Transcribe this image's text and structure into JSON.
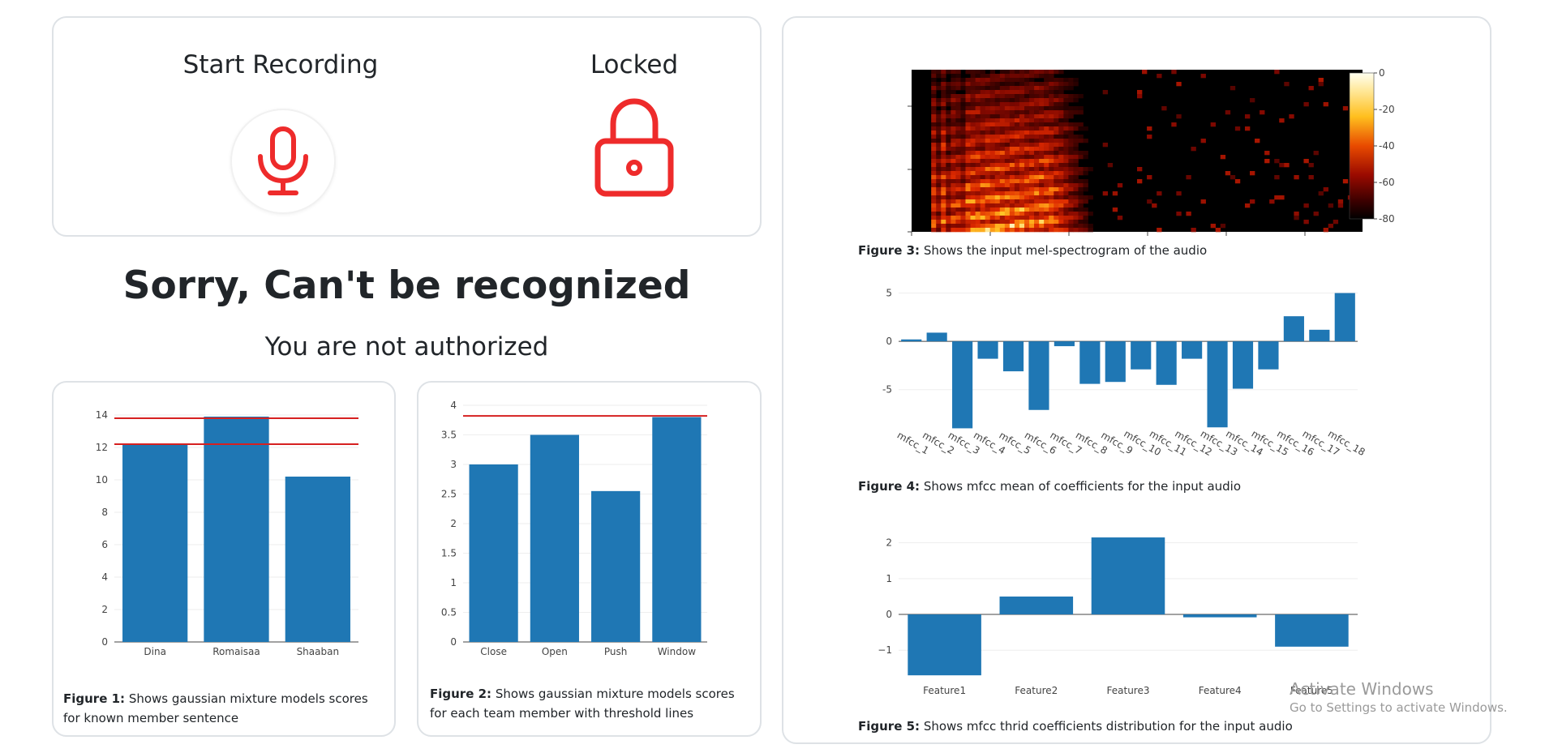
{
  "record": {
    "start_title": "Start Recording",
    "locked_title": "Locked"
  },
  "result": {
    "title": "Sorry, Can't be recognized",
    "subtitle": "You are not authorized"
  },
  "colors": {
    "accent_red": "#ee2b2b",
    "bar_blue": "#1f77b4",
    "threshold_red": "#d62020"
  },
  "icons": {
    "mic": "microphone-icon",
    "lock": "lock-icon"
  },
  "figures": {
    "fig1": {
      "label": "Figure 1:",
      "text": " Shows gaussian mixture models scores for known member sentence"
    },
    "fig2": {
      "label": "Figure 2:",
      "text": " Shows gaussian mixture models scores for each team member with threshold lines"
    },
    "fig3": {
      "label": "Figure 3:",
      "text": " Shows the input mel-spectrogram of the audio"
    },
    "fig4": {
      "label": "Figure 4:",
      "text": " Shows mfcc mean of coefficients for the input audio"
    },
    "fig5": {
      "label": "Figure 5:",
      "text": " Shows mfcc thrid coefficients distribution for the input audio"
    }
  },
  "chart_data": [
    {
      "id": "fig1",
      "type": "bar",
      "categories": [
        "Dina",
        "Romaisaa",
        "Shaaban"
      ],
      "values": [
        12.2,
        13.9,
        10.2
      ],
      "ylim": [
        0,
        14.6
      ],
      "yticks": [
        0,
        2,
        4,
        6,
        8,
        10,
        12,
        14
      ],
      "thresholds": [
        13.8,
        12.2
      ]
    },
    {
      "id": "fig2",
      "type": "bar",
      "categories": [
        "Close",
        "Open",
        "Push",
        "Window"
      ],
      "values": [
        3.0,
        3.5,
        2.55,
        3.8
      ],
      "ylim": [
        0,
        4
      ],
      "yticks": [
        0,
        0.5,
        1,
        1.5,
        2,
        2.5,
        3,
        3.5,
        4
      ],
      "thresholds": [
        3.82
      ]
    },
    {
      "id": "fig3",
      "type": "heatmap",
      "colorbar_ticks": [
        0,
        -20,
        -40,
        -60,
        -80
      ],
      "range": [
        -80,
        0
      ]
    },
    {
      "id": "fig4",
      "type": "bar",
      "categories": [
        "mfcc_1",
        "mfcc_2",
        "mfcc_3",
        "mfcc_4",
        "mfcc_5",
        "mfcc_6",
        "mfcc_7",
        "mfcc_8",
        "mfcc_9",
        "mfcc_10",
        "mfcc_11",
        "mfcc_12",
        "mfcc_13",
        "mfcc_14",
        "mfcc_15",
        "mfcc_16",
        "mfcc_17",
        "mfcc_18"
      ],
      "values": [
        0.2,
        0.9,
        -9.0,
        -1.8,
        -3.1,
        -7.1,
        -0.5,
        -4.4,
        -4.2,
        -2.9,
        -4.5,
        -1.8,
        -8.9,
        -4.9,
        -2.9,
        2.6,
        1.2,
        5.0
      ],
      "ylim": [
        -9.3,
        5.8
      ],
      "yticks": [
        5,
        0,
        -5
      ]
    },
    {
      "id": "fig5",
      "type": "bar",
      "categories": [
        "Feature1",
        "Feature2",
        "Feature3",
        "Feature4",
        "Feature5"
      ],
      "values": [
        -1.7,
        0.5,
        2.15,
        -0.08,
        -0.9
      ],
      "ylim": [
        -1.9,
        2.4
      ],
      "yticks": [
        2,
        1,
        0,
        -1
      ],
      "ytick_labels": [
        "2",
        "1",
        "0",
        "−1"
      ]
    }
  ],
  "watermark": {
    "line1": "Activate Windows",
    "line2": "Go to Settings to activate Windows."
  }
}
